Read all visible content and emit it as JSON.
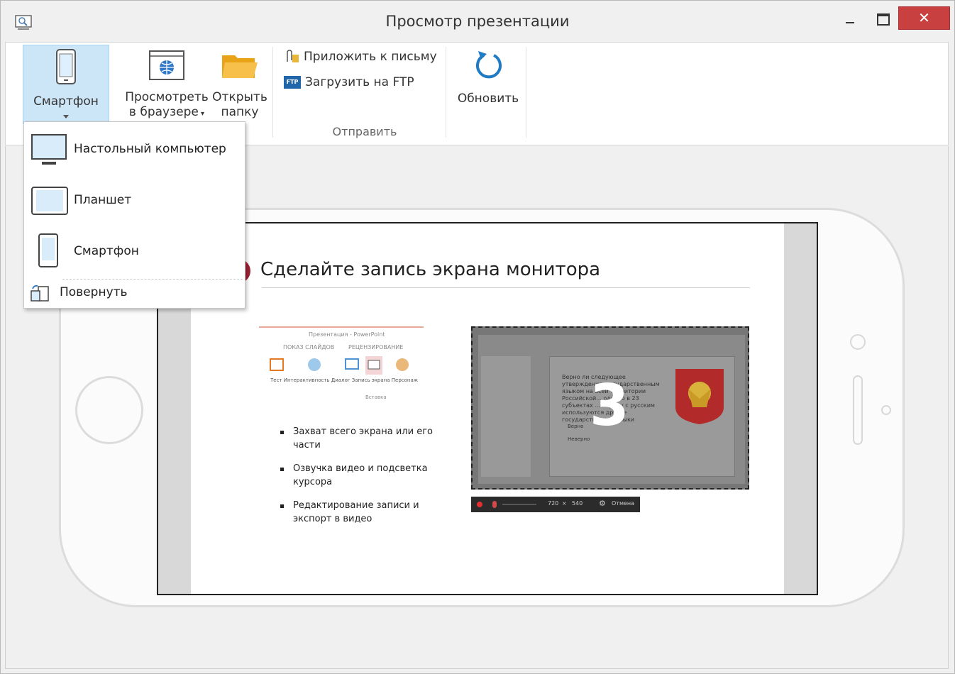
{
  "window": {
    "title": "Просмотр презентации",
    "close_label": "✕"
  },
  "ribbon": {
    "smartphone_label": "Смартфон",
    "browser_label_1": "Просмотреть",
    "browser_label_2": "в браузере",
    "folder_label_1": "Открыть",
    "folder_label_2": "папку",
    "attach_label": "Приложить к письму",
    "ftp_label": "Загрузить на FTP",
    "ftp_badge": "FTP",
    "send_group_label": "Отправить",
    "refresh_label": "Обновить"
  },
  "device_menu": {
    "items": [
      {
        "label": "Настольный компьютер",
        "icon": "desktop-icon"
      },
      {
        "label": "Планшет",
        "icon": "tablet-icon"
      },
      {
        "label": "Смартфон",
        "icon": "smartphone-icon"
      }
    ],
    "rotate_label": "Повернуть"
  },
  "slide": {
    "title": "Сделайте запись экрана монитора",
    "bullets": [
      "Захват всего экрана или его части",
      "Озвучка видео и подсветка курсора",
      "Редактирование записи и экспорт в видео"
    ],
    "thumb": {
      "title": "Презентация - PowerPoint",
      "tab1": "ПОКАЗ СЛАЙДОВ",
      "tab2": "РЕЦЕНЗИРОВАНИЕ",
      "tools": "Тест  Интерактивность  Диалог  Запись экрана  Персонаж",
      "group": "Вставка"
    },
    "capture": {
      "countdown": "3",
      "question": "Верно ли следующее утверждение: государственным языком на всей территории Российской... однако в 23 субъектах ... наряду с русским используются другие государственные языки",
      "option1": "Верно",
      "option2": "Неверно",
      "bar_width": "720",
      "bar_x": "×",
      "bar_height": "540",
      "bar_cancel": "Отмена"
    }
  },
  "colors": {
    "ribbon_active": "#cde6f7",
    "close_button": "#c84040",
    "slide_accent": "#9b2335"
  }
}
